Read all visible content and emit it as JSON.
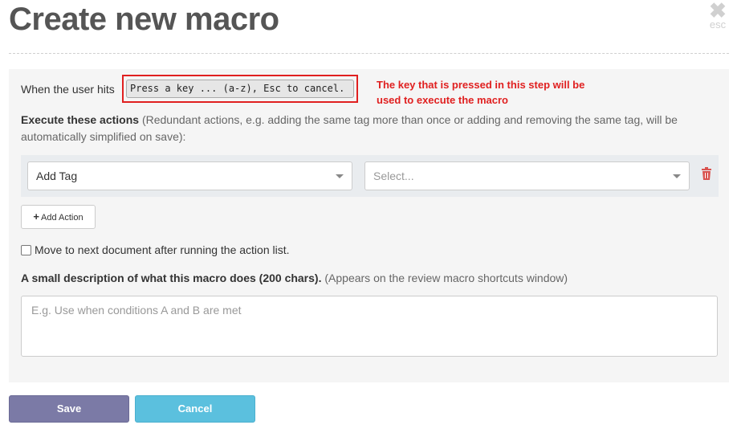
{
  "dialog": {
    "title": "Create new macro",
    "close_icon": "close-icon",
    "close_label": "esc"
  },
  "key_step": {
    "prefix": "When the user hits",
    "input_value": "Press a key ... (a-z), Esc to cancel.",
    "annotation": "The key that is pressed in this step will be used to execute the macro",
    "annotation_color": "#e02020"
  },
  "actions": {
    "heading": "Execute these actions",
    "note": "(Redundant actions, e.g. adding the same tag more than once or adding and removing the same tag, will be automatically simplified on save):",
    "rows": [
      {
        "action_value": "Add Tag",
        "target_placeholder": "Select..."
      }
    ],
    "delete_icon": "trash-icon",
    "add_button_icon": "plus-icon",
    "add_button_label": "Add Action"
  },
  "move_next": {
    "label": "Move to next document after running the action list.",
    "checked": false
  },
  "description": {
    "heading": "A small description of what this macro does (200 chars).",
    "hint": "(Appears on the review macro shortcuts window)",
    "placeholder": "E.g. Use when conditions A and B are met"
  },
  "footer": {
    "save_label": "Save",
    "cancel_label": "Cancel",
    "save_color": "#7b7aa6",
    "cancel_color": "#5bc0de"
  }
}
